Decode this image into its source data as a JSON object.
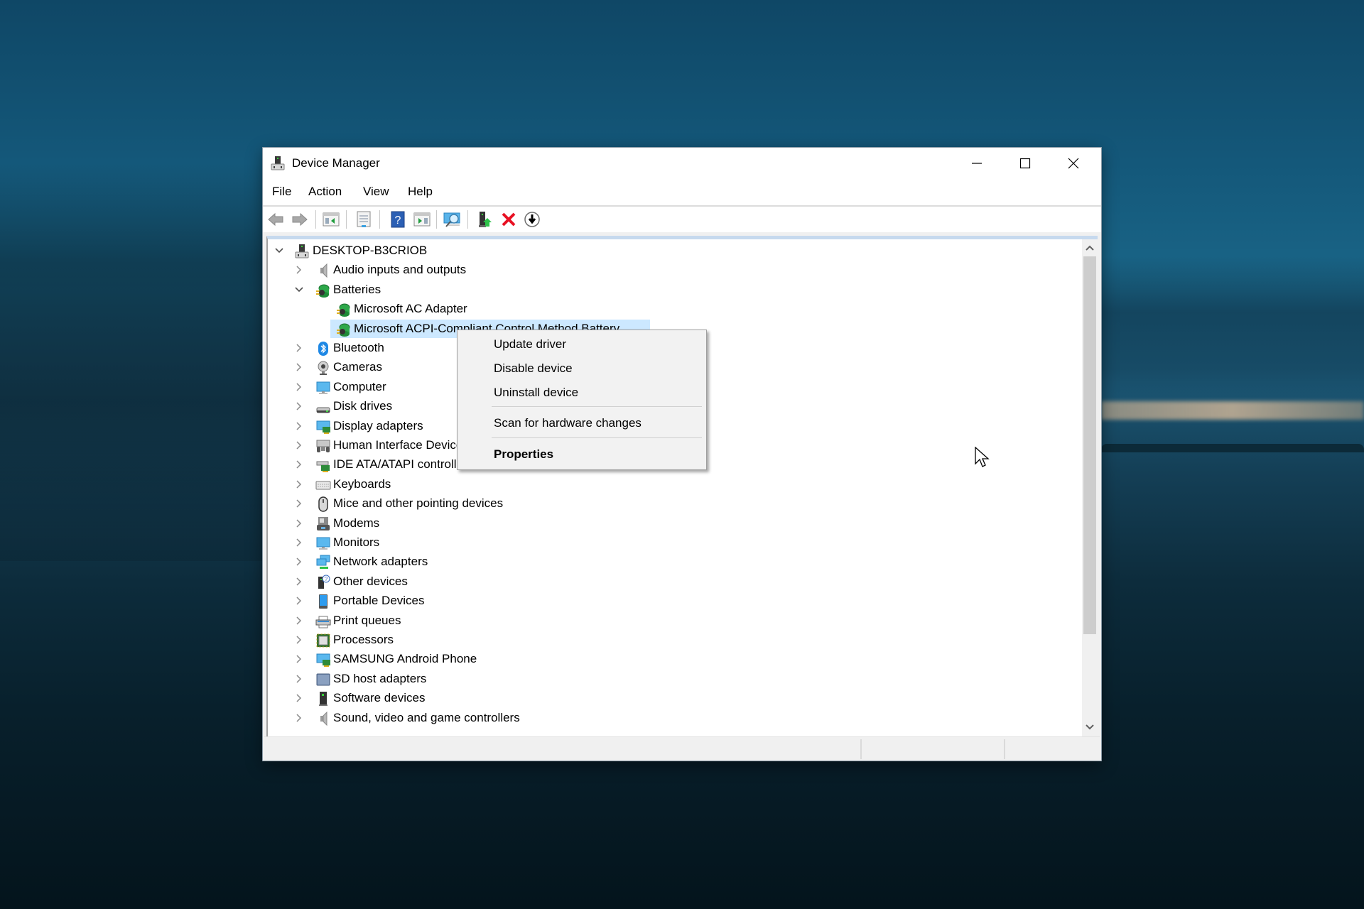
{
  "window": {
    "title": "Device Manager",
    "app_icon": "device-manager-icon",
    "controls": {
      "minimize": "minimize-icon",
      "maximize": "maximize-icon",
      "close": "close-icon"
    }
  },
  "menubar": {
    "items": [
      {
        "label": "File"
      },
      {
        "label": "Action"
      },
      {
        "label": "View"
      },
      {
        "label": "Help"
      }
    ]
  },
  "toolbar": {
    "buttons": [
      {
        "icon": "back-arrow-icon",
        "tooltip_name": "back"
      },
      {
        "icon": "forward-arrow-icon",
        "tooltip_name": "forward"
      },
      {
        "icon": "show-hide-console-tree-icon",
        "tooltip_name": "show-hide-console-tree"
      },
      {
        "icon": "properties-icon",
        "tooltip_name": "properties"
      },
      {
        "icon": "help-icon",
        "tooltip_name": "help"
      },
      {
        "icon": "show-hide-action-pane-icon",
        "tooltip_name": "show-hide-action-pane"
      },
      {
        "icon": "scan-hardware-icon",
        "tooltip_name": "scan-for-hardware-changes"
      },
      {
        "icon": "update-driver-icon",
        "tooltip_name": "update-driver"
      },
      {
        "icon": "uninstall-device-icon",
        "tooltip_name": "uninstall-device"
      },
      {
        "icon": "enable-device-icon",
        "tooltip_name": "enable-device"
      }
    ]
  },
  "tree": {
    "root": {
      "label": "DESKTOP-B3CRIOB",
      "expanded": true,
      "icon": "computer-tower-icon"
    },
    "categories": [
      {
        "label": "Audio inputs and outputs",
        "icon": "speaker-icon",
        "expanded": false
      },
      {
        "label": "Batteries",
        "icon": "battery-icon",
        "expanded": true,
        "children": [
          {
            "label": "Microsoft AC Adapter",
            "icon": "battery-icon",
            "selected": false
          },
          {
            "label": "Microsoft ACPI-Compliant Control Method Battery",
            "icon": "battery-icon",
            "selected": true
          }
        ]
      },
      {
        "label": "Bluetooth",
        "icon": "bluetooth-icon",
        "expanded": false
      },
      {
        "label": "Cameras",
        "icon": "webcam-icon",
        "expanded": false
      },
      {
        "label": "Computer",
        "icon": "monitor-icon",
        "expanded": false
      },
      {
        "label": "Disk drives",
        "icon": "disk-drive-icon",
        "expanded": false
      },
      {
        "label": "Display adapters",
        "icon": "display-adapter-icon",
        "expanded": false
      },
      {
        "label": "Human Interface Devices",
        "icon": "hid-icon",
        "expanded": false
      },
      {
        "label": "IDE ATA/ATAPI controllers",
        "icon": "ide-controller-icon",
        "expanded": false
      },
      {
        "label": "Keyboards",
        "icon": "keyboard-icon",
        "expanded": false
      },
      {
        "label": "Mice and other pointing devices",
        "icon": "mouse-icon",
        "expanded": false
      },
      {
        "label": "Modems",
        "icon": "modem-icon",
        "expanded": false
      },
      {
        "label": "Monitors",
        "icon": "monitor-icon",
        "expanded": false
      },
      {
        "label": "Network adapters",
        "icon": "network-icon",
        "expanded": false
      },
      {
        "label": "Other devices",
        "icon": "unknown-device-icon",
        "expanded": false
      },
      {
        "label": "Portable Devices",
        "icon": "portable-device-icon",
        "expanded": false
      },
      {
        "label": "Print queues",
        "icon": "printer-icon",
        "expanded": false
      },
      {
        "label": "Processors",
        "icon": "processor-icon",
        "expanded": false
      },
      {
        "label": "SAMSUNG Android Phone",
        "icon": "display-adapter-icon",
        "expanded": false
      },
      {
        "label": "SD host adapters",
        "icon": "sd-card-icon",
        "expanded": false
      },
      {
        "label": "Software devices",
        "icon": "software-device-icon",
        "expanded": false
      },
      {
        "label": "Sound, video and game controllers",
        "icon": "speaker-icon",
        "expanded": false
      }
    ]
  },
  "context_menu": {
    "items": [
      {
        "label": "Update driver",
        "bold": false
      },
      {
        "label": "Disable device",
        "bold": false
      },
      {
        "label": "Uninstall device",
        "bold": false
      },
      {
        "separator": true
      },
      {
        "label": "Scan for hardware changes",
        "bold": false
      },
      {
        "separator": true
      },
      {
        "label": "Properties",
        "bold": true
      }
    ]
  },
  "statusbar": {
    "panes": [
      "",
      "",
      ""
    ]
  },
  "colors": {
    "selection": "#cce8ff",
    "window_bg": "#f0f0f0",
    "uninstall_red": "#e81123",
    "help_blue": "#2b5fb4"
  }
}
